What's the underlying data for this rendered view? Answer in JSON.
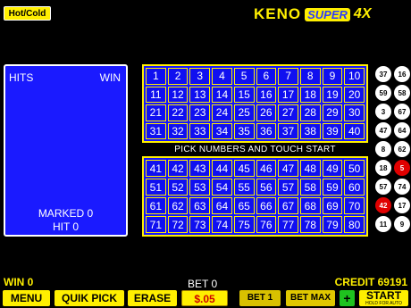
{
  "header": {
    "hot_cold_label": "Hot/Cold",
    "logo_keno": "KENO",
    "logo_super": "SUPER",
    "logo_4x": "4X"
  },
  "paytable": {
    "hits_label": "HITS",
    "win_label": "WIN",
    "marked_text": "MARKED 0",
    "hit_text": "HIT 0"
  },
  "board": {
    "instruction": "PICK NUMBERS AND TOUCH START",
    "top_rows": [
      [
        "1",
        "2",
        "3",
        "4",
        "5",
        "6",
        "7",
        "8",
        "9",
        "10"
      ],
      [
        "11",
        "12",
        "13",
        "14",
        "15",
        "16",
        "17",
        "18",
        "19",
        "20"
      ],
      [
        "21",
        "22",
        "23",
        "24",
        "25",
        "26",
        "27",
        "28",
        "29",
        "30"
      ],
      [
        "31",
        "32",
        "33",
        "34",
        "35",
        "36",
        "37",
        "38",
        "39",
        "40"
      ]
    ],
    "bottom_rows": [
      [
        "41",
        "42",
        "43",
        "44",
        "45",
        "46",
        "47",
        "48",
        "49",
        "50"
      ],
      [
        "51",
        "52",
        "53",
        "54",
        "55",
        "56",
        "57",
        "58",
        "59",
        "60"
      ],
      [
        "61",
        "62",
        "63",
        "64",
        "65",
        "66",
        "67",
        "68",
        "69",
        "70"
      ],
      [
        "71",
        "72",
        "73",
        "74",
        "75",
        "76",
        "77",
        "78",
        "79",
        "80"
      ]
    ]
  },
  "drawn_balls": [
    {
      "n": "37",
      "red": false
    },
    {
      "n": "16",
      "red": false
    },
    {
      "n": "59",
      "red": false
    },
    {
      "n": "58",
      "red": false
    },
    {
      "n": "3",
      "red": false
    },
    {
      "n": "67",
      "red": false
    },
    {
      "n": "47",
      "red": false
    },
    {
      "n": "64",
      "red": false
    },
    {
      "n": "8",
      "red": false
    },
    {
      "n": "62",
      "red": false
    },
    {
      "n": "18",
      "red": false
    },
    {
      "n": "5",
      "red": true
    },
    {
      "n": "57",
      "red": false
    },
    {
      "n": "74",
      "red": false
    },
    {
      "n": "42",
      "red": true
    },
    {
      "n": "17",
      "red": false
    },
    {
      "n": "11",
      "red": false
    },
    {
      "n": "9",
      "red": false
    }
  ],
  "status": {
    "win_text": "WIN 0",
    "bet_text": "BET 0",
    "credit_text": "CREDIT 69191"
  },
  "buttons": {
    "menu": "MENU",
    "quik_pick": "QUIK PICK",
    "erase": "ERASE",
    "amount": "$.05",
    "bet1": "BET 1",
    "bet_max": "BET MAX",
    "plus": "+",
    "start": "START",
    "start_sub": "HOLD FOR AUTO"
  },
  "colors": {
    "accent_yellow": "#ffef00",
    "panel_blue": "#1414ff",
    "ball_red": "#e00000",
    "plus_green": "#1fc21f"
  }
}
